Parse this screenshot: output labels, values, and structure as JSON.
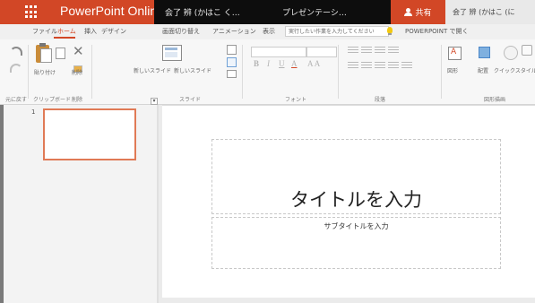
{
  "titlebar": {
    "app_name": "PowerPoint Online",
    "path_part1": "会了 辨 (かはこ く…",
    "file_name": "プレゼンテーシ…",
    "share_label": "共有",
    "right_text": "会了 辨 (かはこ (に"
  },
  "tabs": [
    {
      "label": "ファイル",
      "active": false
    },
    {
      "label": "ホーム",
      "active": true
    },
    {
      "label": "挿入",
      "active": false
    },
    {
      "label": "デザイン",
      "active": false
    },
    {
      "label": "画面切り替え",
      "active": false
    },
    {
      "label": "アニメーション",
      "active": false
    },
    {
      "label": "表示",
      "active": false
    }
  ],
  "tellme": {
    "placeholder": "実行したい作業を入力してください",
    "open_label": "POWERPOINT で開く"
  },
  "ribbon": {
    "groups": {
      "undo": "元に戻す",
      "clipboard": "クリップボード",
      "delete": "削除",
      "slides": "スライド",
      "font": "フォント",
      "paragraph": "段落",
      "drawing": "図形描画"
    },
    "paste_label": "貼り付け",
    "delete_label": "削除",
    "new_slide_label": "新しいスライド",
    "new_slide_sub": "新しいスライド",
    "textbox_label": "図形",
    "arrange_label": "配置",
    "quickstyle_label": "クイックスタイル",
    "format_bold": "B",
    "format_italic": "I",
    "format_underline": "U",
    "format_color": "A",
    "format_size": "A A"
  },
  "thumbnails": [
    {
      "number": "1"
    }
  ],
  "slide": {
    "title_placeholder": "タイトルを入力",
    "subtitle_placeholder": "サブタイトルを入力"
  },
  "colors": {
    "accent": "#d24726",
    "titlebar_dark": "#0d0d0d"
  }
}
